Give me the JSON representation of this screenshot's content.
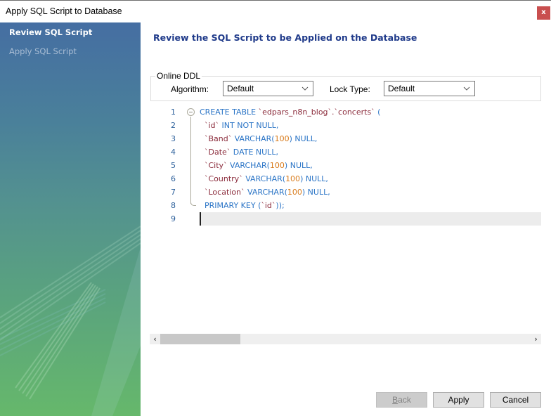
{
  "window": {
    "title": "Apply SQL Script to Database",
    "close_label": "x"
  },
  "sidebar": {
    "items": [
      {
        "label": "Review SQL Script",
        "active": true
      },
      {
        "label": "Apply SQL Script",
        "active": false
      }
    ]
  },
  "page": {
    "heading": "Review the SQL Script to be Applied on the Database"
  },
  "online_ddl": {
    "legend": "Online DDL",
    "algorithm_label": "Algorithm:",
    "algorithm_value": "Default",
    "lock_type_label": "Lock Type:",
    "lock_type_value": "Default"
  },
  "editor": {
    "line_numbers": [
      "1",
      "2",
      "3",
      "4",
      "5",
      "6",
      "7",
      "8",
      "9"
    ],
    "lines": [
      [
        {
          "t": "kw",
          "v": "CREATE TABLE "
        },
        {
          "t": "ident",
          "v": "`edpars_n8n_blog`.`concerts`"
        },
        {
          "t": "kw",
          "v": " ("
        }
      ],
      [
        {
          "t": "ident",
          "v": "  `id`"
        },
        {
          "t": "kw",
          "v": " INT NOT NULL,"
        }
      ],
      [
        {
          "t": "ident",
          "v": "  `Band`"
        },
        {
          "t": "kw",
          "v": " VARCHAR("
        },
        {
          "t": "num",
          "v": "100"
        },
        {
          "t": "kw",
          "v": ") NULL,"
        }
      ],
      [
        {
          "t": "ident",
          "v": "  `Date`"
        },
        {
          "t": "kw",
          "v": " DATE NULL,"
        }
      ],
      [
        {
          "t": "ident",
          "v": "  `City`"
        },
        {
          "t": "kw",
          "v": " VARCHAR("
        },
        {
          "t": "num",
          "v": "100"
        },
        {
          "t": "kw",
          "v": ") NULL,"
        }
      ],
      [
        {
          "t": "ident",
          "v": "  `Country`"
        },
        {
          "t": "kw",
          "v": " VARCHAR("
        },
        {
          "t": "num",
          "v": "100"
        },
        {
          "t": "kw",
          "v": ") NULL,"
        }
      ],
      [
        {
          "t": "ident",
          "v": "  `Location`"
        },
        {
          "t": "kw",
          "v": " VARCHAR("
        },
        {
          "t": "num",
          "v": "100"
        },
        {
          "t": "kw",
          "v": ") NULL,"
        }
      ],
      [
        {
          "t": "kw",
          "v": "  PRIMARY KEY ("
        },
        {
          "t": "ident",
          "v": "`id`"
        },
        {
          "t": "kw",
          "v": "));"
        }
      ],
      []
    ],
    "colors": {
      "keyword": "#2a74c6",
      "identifier": "#8a2a3a",
      "number": "#d87a1a",
      "line_number": "#2b5f9a"
    },
    "scroll_left_icon": "chevron-left-icon",
    "scroll_right_icon": "chevron-right-icon"
  },
  "buttons": {
    "back_label_underlined": "B",
    "back_label_rest": "ack",
    "apply_label": "Apply",
    "cancel_label": "Cancel"
  },
  "colors": {
    "heading": "#1f3a8a",
    "close_button": "#c94f4f",
    "sidebar_top": "#456ea2",
    "sidebar_bottom": "#66b86b"
  }
}
